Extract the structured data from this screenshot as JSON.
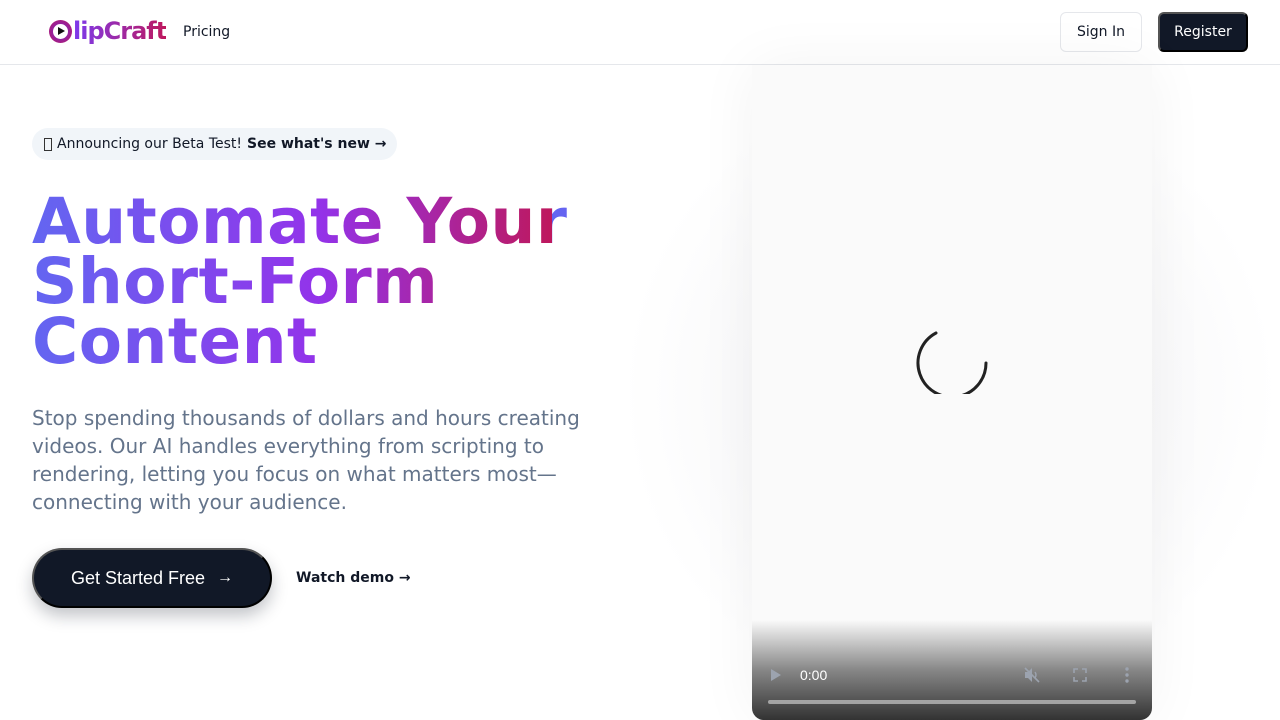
{
  "header": {
    "logo_text": "lipCraft",
    "nav_pricing": "Pricing",
    "sign_in": "Sign In",
    "register": "Register"
  },
  "announcement": {
    "text": "Announcing our Beta Test!",
    "link": "See what's new →"
  },
  "hero": {
    "headline_line1": "Automate Your",
    "headline_line2": "Short-Form",
    "headline_line3": "Content",
    "subtext": "Stop spending thousands of dollars and hours creating videos. Our AI handles everything from scripting to rendering, letting you focus on what matters most—connecting with your audience.",
    "cta_label": "Get Started Free",
    "cta_arrow": "→",
    "watch_demo": "Watch demo →"
  },
  "video": {
    "time": "0:00",
    "progress": 0,
    "icons": [
      "play-icon",
      "muted-icon",
      "fullscreen-icon",
      "more-options-icon"
    ]
  },
  "colors": {
    "primary_dark": "#111827",
    "gradient_start": "#6366f1",
    "gradient_mid": "#9333ea",
    "gradient_end": "#be185d",
    "muted_text": "#64748b"
  }
}
